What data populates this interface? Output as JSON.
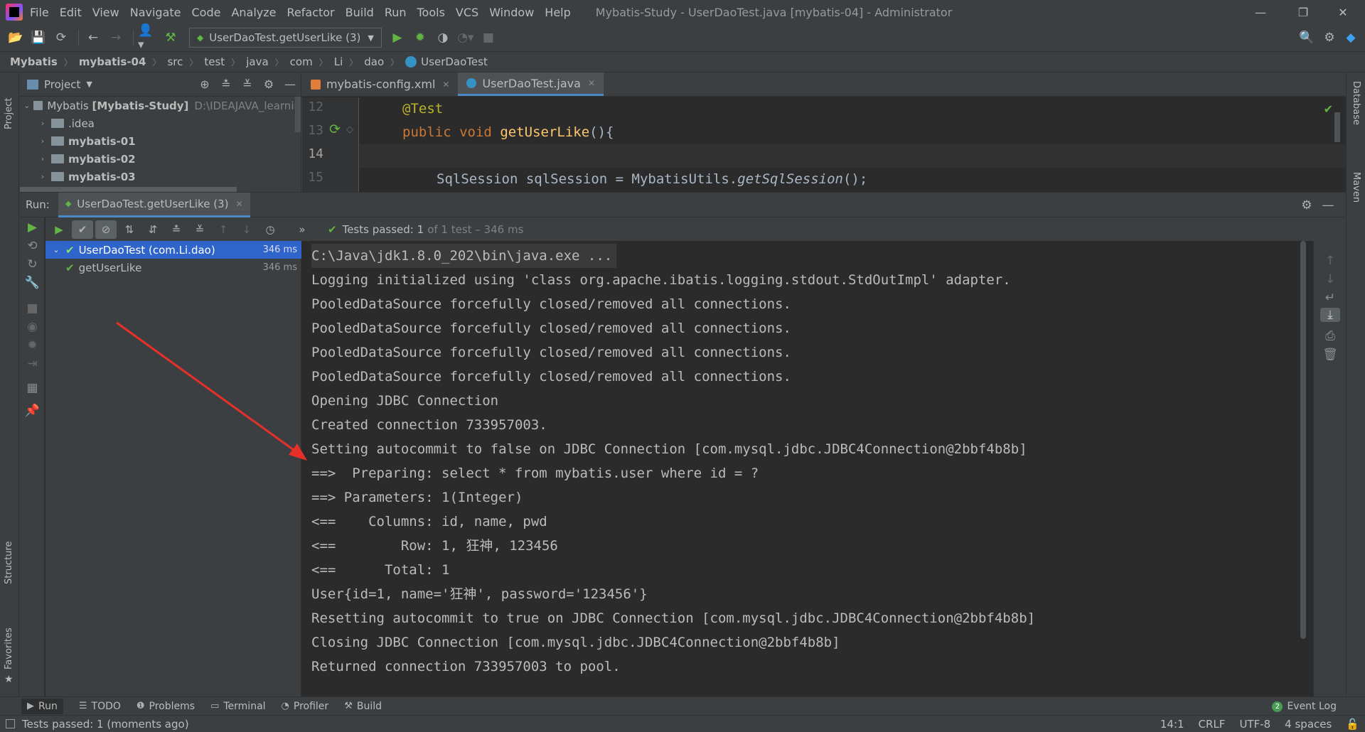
{
  "menu": {
    "items": [
      "File",
      "Edit",
      "View",
      "Navigate",
      "Code",
      "Analyze",
      "Refactor",
      "Build",
      "Run",
      "Tools",
      "VCS",
      "Window",
      "Help"
    ],
    "window_title": "Mybatis-Study - UserDaoTest.java [mybatis-04] - Administrator"
  },
  "toolbar": {
    "run_config": "UserDaoTest.getUserLike (3)"
  },
  "breadcrumb": [
    "Mybatis",
    "mybatis-04",
    "src",
    "test",
    "java",
    "com",
    "Li",
    "dao",
    "UserDaoTest"
  ],
  "project": {
    "header": "Project",
    "root_name": "Mybatis",
    "root_module": "[Mybatis-Study]",
    "root_path": "D:\\IDEAJAVA_learnin",
    "items": [
      ".idea",
      "mybatis-01",
      "mybatis-02",
      "mybatis-03"
    ]
  },
  "editor": {
    "tabs": [
      "mybatis-config.xml",
      "UserDaoTest.java"
    ],
    "active_tab": "UserDaoTest.java",
    "line_numbers": [
      "12",
      "13",
      "14",
      "15"
    ],
    "lines": {
      "l12_annotation": "@Test",
      "l13_kw1": "public",
      "l13_kw2": "void",
      "l13_method": "getUserLike",
      "l13_rest": "(){",
      "l15_start": "SqlSession sqlSession = MybatisUtils.",
      "l15_call": "getSqlSession",
      "l15_end": "();"
    }
  },
  "run": {
    "label": "Run:",
    "tab": "UserDaoTest.getUserLike (3)",
    "status_prefix": "Tests passed:",
    "status_count": "1",
    "status_detail": "of 1 test – 346 ms",
    "tree": [
      {
        "label": "UserDaoTest (com.Li.dao)",
        "time": "346 ms"
      },
      {
        "label": "getUserLike",
        "time": "346 ms"
      }
    ],
    "console": [
      "C:\\Java\\jdk1.8.0_202\\bin\\java.exe ...",
      "Logging initialized using 'class org.apache.ibatis.logging.stdout.StdOutImpl' adapter.",
      "PooledDataSource forcefully closed/removed all connections.",
      "PooledDataSource forcefully closed/removed all connections.",
      "PooledDataSource forcefully closed/removed all connections.",
      "PooledDataSource forcefully closed/removed all connections.",
      "Opening JDBC Connection",
      "Created connection 733957003.",
      "Setting autocommit to false on JDBC Connection [com.mysql.jdbc.JDBC4Connection@2bbf4b8b]",
      "==>  Preparing: select * from mybatis.user where id = ?",
      "==> Parameters: 1(Integer)",
      "<==    Columns: id, name, pwd",
      "<==        Row: 1, 狂神, 123456",
      "<==      Total: 1",
      "User{id=1, name='狂神', password='123456'}",
      "Resetting autocommit to true on JDBC Connection [com.mysql.jdbc.JDBC4Connection@2bbf4b8b]",
      "Closing JDBC Connection [com.mysql.jdbc.JDBC4Connection@2bbf4b8b]",
      "Returned connection 733957003 to pool."
    ]
  },
  "side_tools": {
    "left_top": "Project",
    "left_structure": "Structure",
    "left_favorites": "Favorites",
    "right_database": "Database",
    "right_maven": "Maven"
  },
  "bottom_tools": [
    "Run",
    "TODO",
    "Problems",
    "Terminal",
    "Profiler",
    "Build"
  ],
  "event_log": {
    "count": "2",
    "label": "Event Log"
  },
  "status_bar": {
    "message": "Tests passed: 1 (moments ago)",
    "position": "14:1",
    "line_sep": "CRLF",
    "encoding": "UTF-8",
    "indent": "4 spaces"
  },
  "colors": {
    "accent": "#4a88c7",
    "success": "#62b543",
    "selection": "#2f65ca",
    "arrow": "#e8302a"
  }
}
